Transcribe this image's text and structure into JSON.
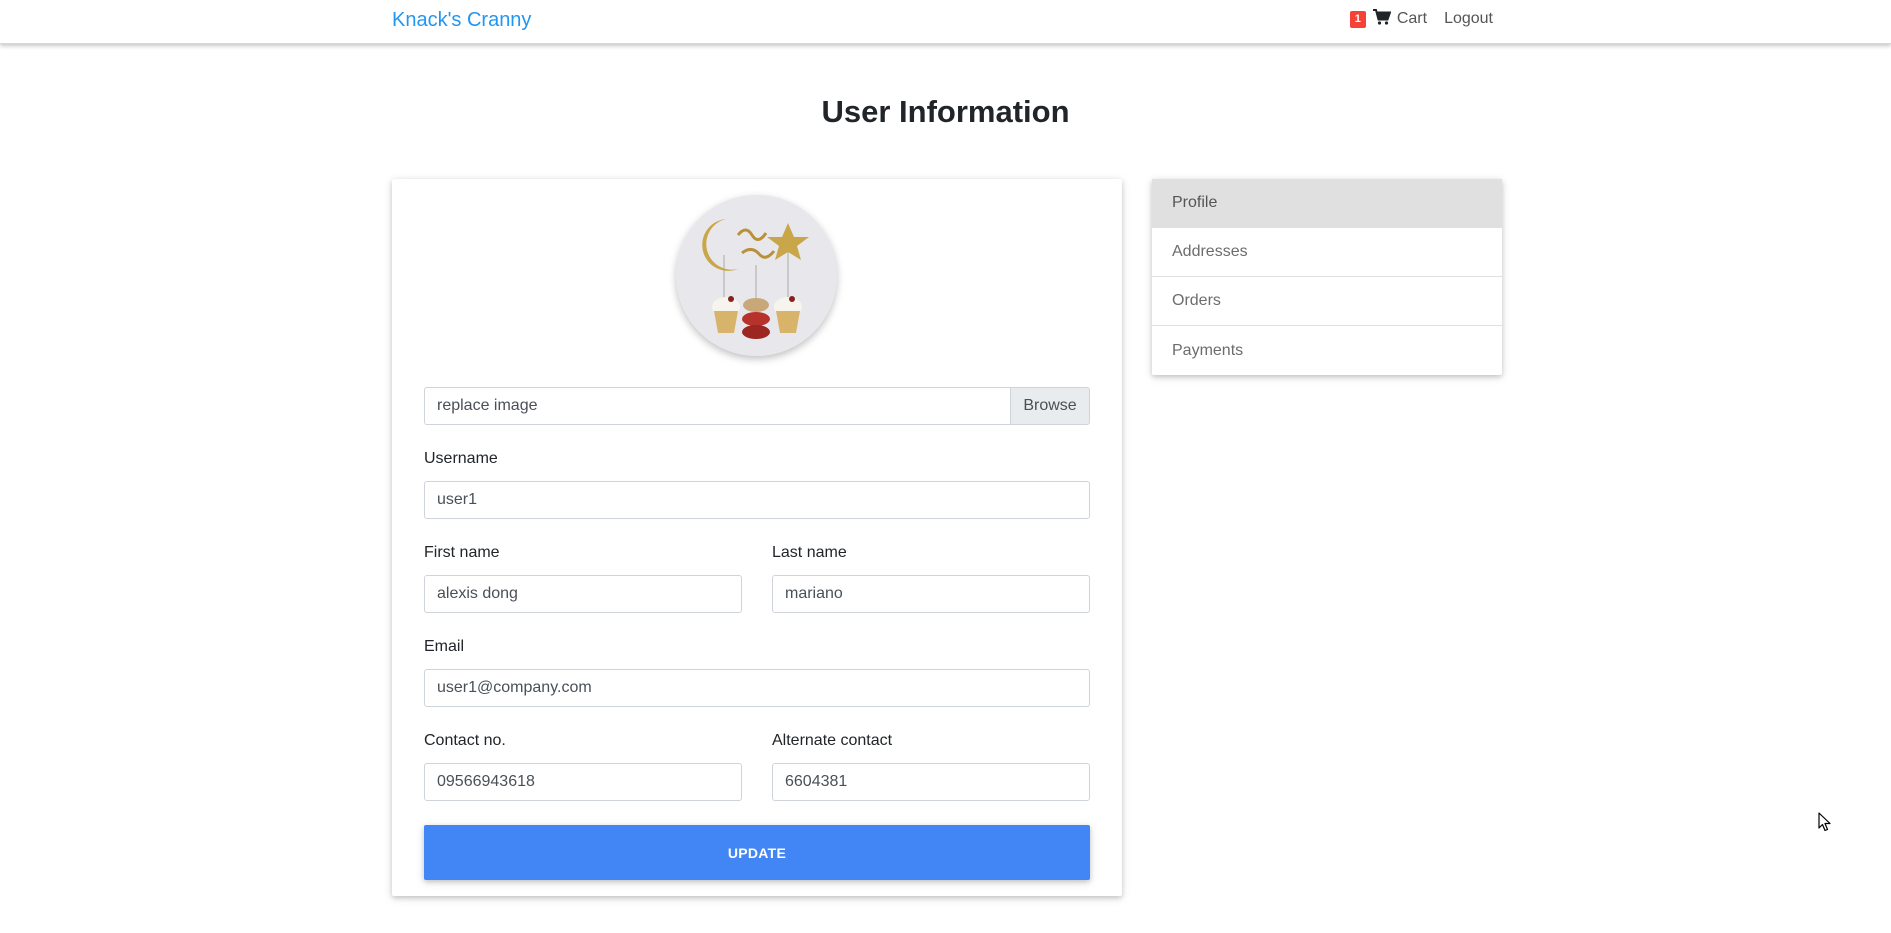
{
  "navbar": {
    "brand": "Knack's Cranny",
    "cart_count": "1",
    "cart_label": "Cart",
    "logout_label": "Logout"
  },
  "page_title": "User Information",
  "profile_form": {
    "avatar_alt": "cake topper with cupcakes and macaron",
    "file_input_value": "replace image",
    "browse_label": "Browse",
    "username_label": "Username",
    "username_value": "user1",
    "first_name_label": "First name",
    "first_name_value": "alexis dong",
    "last_name_label": "Last name",
    "last_name_value": "mariano",
    "email_label": "Email",
    "email_value": "user1@company.com",
    "contact_label": "Contact no.",
    "contact_value": "09566943618",
    "alt_contact_label": "Alternate contact",
    "alt_contact_value": "6604381",
    "update_label": "UPDATE"
  },
  "sidebar": {
    "items": [
      {
        "label": "Profile",
        "active": true
      },
      {
        "label": "Addresses",
        "active": false
      },
      {
        "label": "Orders",
        "active": false
      },
      {
        "label": "Payments",
        "active": false
      }
    ]
  },
  "colors": {
    "brand": "#2196f3",
    "badge": "#f44336",
    "primary_button": "#4285f4",
    "active_item_bg": "#e0e0e0"
  },
  "icons": {
    "cart": "shopping-cart-icon"
  }
}
